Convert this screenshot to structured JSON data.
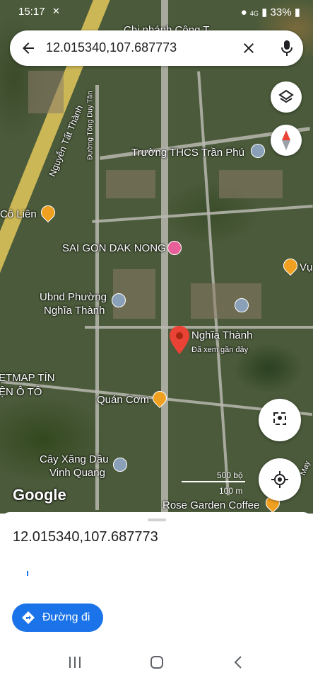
{
  "status_bar": {
    "time": "15:17",
    "signal_text": "4G",
    "battery": "33%"
  },
  "search": {
    "query": "12.015340,107.687773"
  },
  "map": {
    "labels": {
      "top_cut": "Chi nhánh Cộng T",
      "nguyen_tat_thanh": "Nguyễn Tất Thành",
      "duong_tong_duy_tan": "Đường Tông Duy Tân",
      "truong_thcs": "Trường THCS Trần Phú",
      "co_lien": "Cô Liên",
      "saigon_daknong": "SAI GON DAK NONG",
      "vu_cut": "Vụ",
      "ubnd_line1": "Ubnd Phường",
      "ubnd_line2": "Nghĩa Thành",
      "pin_title": "Nghĩa Thành",
      "pin_subtitle": "Đã xem gần đây",
      "etmap_line1": "ETMAP TÍN",
      "etmap_line2": "ỆN Ô TÔ",
      "quan_com": "Quán Cơm",
      "cay_xang_line1": "Cây Xăng Dầu",
      "cay_xang_line2": "Vinh Quang",
      "rose_garden": "Rose Garden Coffee",
      "may_cut": "May"
    },
    "scale": {
      "feet": "500 bộ",
      "meters": "100 m"
    },
    "logo": "Google",
    "colors": {
      "pin_red": "#ea4335",
      "food_pin": "#f0a020",
      "hotel_pin": "#e8609a",
      "accent": "#1a73e8"
    }
  },
  "sheet": {
    "title": "12.015340,107.687773",
    "directions_label": "Đường đi"
  }
}
